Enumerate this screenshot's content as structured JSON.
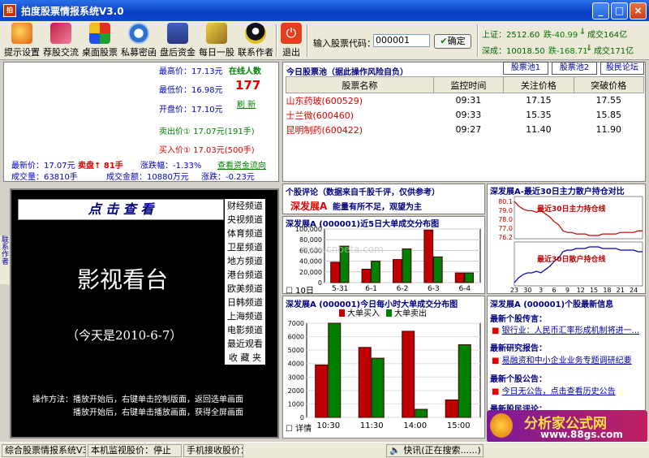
{
  "window": {
    "title": "拍度股票情报系统V3.0",
    "icon_text": "拍"
  },
  "toolbar": {
    "buttons": [
      "提示设置",
      "荐股交流",
      "桌面股票",
      "私募密函",
      "盘后资金",
      "每日一股",
      "联系作者",
      "退出"
    ],
    "code_label": "输入股票代码：",
    "code_value": "000001",
    "confirm": "确定"
  },
  "index": {
    "sh_label": "上证：2512.60",
    "sh_change": "跌-40.99",
    "sh_vol": "成交164亿",
    "sz_label": "深成：10018.50",
    "sz_change": "跌-168.71",
    "sz_vol": "成交171亿"
  },
  "quote": {
    "high": "最高价：17.13元",
    "low": "最低价：16.98元",
    "open": "开盘价：17.10元",
    "sell1": "卖出价① 17.07元(191手)",
    "buy1": "买入价① 17.03元(500手)",
    "online_label": "在线人数",
    "online_count": "177",
    "refresh": "刷 新",
    "latest": "最新价：17.07元",
    "sell_pan": "卖盘↑ 81手",
    "change_pct": "涨跌幅：-1.33%",
    "fund_flow": "查看资金流向",
    "volume": "成交量：63810手",
    "amount": "成交金额：10880万元",
    "change": "涨跌：-0.23元"
  },
  "video": {
    "click_view": "点 击 查 看",
    "title": "影视看台",
    "date": "（今天是2010-6-7）",
    "channels": [
      "财经频道",
      "央视频道",
      "体育频道",
      "卫星频道",
      "地方频道",
      "港台频道",
      "欧美频道",
      "日韩频道",
      "上海频道",
      "电影频道",
      "最近观看",
      "收 藏 夹"
    ],
    "help1": "操作方法：播放开始后，右键单击控制版面，返回选单画面",
    "help2": "播放开始后，右键单击播放画面，获得全屏画面",
    "side": "联系作者"
  },
  "pool": {
    "title": "今日股票池（据此操作风险自负）",
    "tabs": [
      "股票池1",
      "股票池2",
      "股民论坛"
    ],
    "headers": [
      "股票名称",
      "监控时间",
      "关注价格",
      "突破价格"
    ],
    "rows": [
      [
        "山东药玻(600529)",
        "09:31",
        "17.15",
        "17.55"
      ],
      [
        "士兰微(600460)",
        "09:33",
        "15.35",
        "15.85"
      ],
      [
        "昆明制药(600422)",
        "09:27",
        "11.40",
        "11.90"
      ]
    ]
  },
  "comment": {
    "title": "个股评论（数据来自千股千评，仅供参考）",
    "name": "深发展A",
    "text": "能量有所不足，观望为主"
  },
  "chart5": {
    "title": "深发展A (000001)近5日大单成交分布图",
    "check": "10日"
  },
  "chart_hour": {
    "title": "深发展A (000001)今日每小时大单成交分布图",
    "check": "详情"
  },
  "mainforce": {
    "title": "深发展A-最近30日主力散户持仓对比",
    "label1": "最近30日主力持仓线",
    "label2": "最近30日散户持仓线"
  },
  "news": {
    "title": "深发展A (000001)个股最新信息",
    "sections": [
      {
        "head": "最新个股传言：",
        "item": "银行业：人民币汇率形成机制将进一..."
      },
      {
        "head": "最新研究报告：",
        "item": "易融资和中小企业业务专题调研纪要"
      },
      {
        "head": "最新个股公告：",
        "item": "今日无公告，点击查看历史公告"
      },
      {
        "head": "最新股民评论：",
        "item": ""
      }
    ]
  },
  "status": {
    "s1": "综合股票情报系统V3.0",
    "s2": "本机监视股价：停止",
    "s3": "手机接收股价：停止",
    "s4": "快讯(正在搜索......)"
  },
  "watermark": {
    "text1": "分析家公式网",
    "text2": "www.88gs.com",
    "center": "www.cnbeta.com"
  },
  "colors": {
    "buy": "#c00000",
    "sell": "#008000",
    "accent": "#0000c0",
    "title_bg": "#0a3fc4"
  },
  "chart_data": [
    {
      "type": "bar",
      "title": "深发展A (000001)近5日大单成交分布图",
      "categories": [
        "5-31",
        "6-1",
        "6-2",
        "6-3",
        "6-4"
      ],
      "series": [
        {
          "name": "",
          "values": [
            38000,
            25000,
            43000,
            98000,
            18000
          ]
        },
        {
          "name": "",
          "values": [
            68000,
            40000,
            63000,
            48000,
            18000
          ]
        }
      ],
      "yticks": [
        "0",
        "20,000",
        "40,000",
        "60,000",
        "80,000",
        "100,000"
      ],
      "ylim": [
        0,
        100000
      ]
    },
    {
      "type": "bar",
      "title": "深发展A (000001)今日每小时大单成交分布图",
      "categories": [
        "10:30",
        "11:30",
        "14:00",
        "15:00"
      ],
      "series": [
        {
          "name": "大单买入",
          "values": [
            3900,
            5200,
            6400,
            1300
          ]
        },
        {
          "name": "大单卖出",
          "values": [
            7000,
            4400,
            600,
            5400
          ]
        }
      ],
      "yticks": [
        "0",
        "1000",
        "2000",
        "3000",
        "4000",
        "5000",
        "6000",
        "7000"
      ],
      "ylim": [
        0,
        7000
      ]
    },
    {
      "type": "line",
      "title": "深发展A-最近30日主力散户持仓对比",
      "x": [
        "23",
        "25",
        "28",
        "30",
        "1",
        "2",
        "3",
        "4",
        "5",
        "6",
        "7",
        "8",
        "9",
        "10",
        "11",
        "12",
        "13",
        "14",
        "15",
        "16",
        "17",
        "18",
        "19",
        "20",
        "21",
        "22",
        "23",
        "24",
        "25",
        "26"
      ],
      "series": [
        {
          "name": "最近30日主力持仓线",
          "values": [
            79.5,
            79.2,
            79.0,
            78.9,
            78.9,
            78.8,
            78.9,
            78.7,
            78.5,
            78.2,
            78.0,
            77.6,
            77.5,
            77.5,
            77.4,
            77.4,
            77.4,
            77.3,
            77.3,
            77.3,
            77.4,
            77.4,
            77.4,
            77.4,
            77.5,
            77.5,
            77.5,
            77.5,
            77.6,
            77.6
          ]
        },
        {
          "name": "最近30日散户持仓线",
          "values": [
            20.5,
            20.8,
            21.0,
            21.1,
            21.1,
            21.2,
            21.1,
            21.3,
            21.5,
            21.8,
            22.0,
            22.4,
            22.5,
            22.5,
            22.6,
            22.6,
            22.6,
            22.7,
            22.7,
            22.7,
            22.6,
            22.6,
            22.6,
            22.6,
            22.5,
            22.5,
            22.5,
            22.5,
            22.4,
            22.4
          ]
        }
      ],
      "yticks": [
        "80.1",
        "79.0",
        "78.0",
        "77.0",
        "76.2"
      ]
    }
  ]
}
